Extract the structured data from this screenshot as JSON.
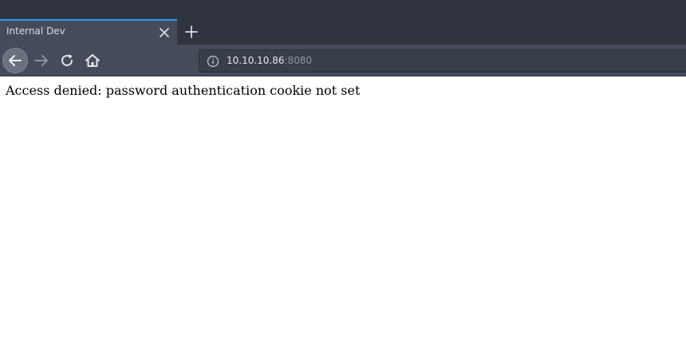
{
  "tab": {
    "title": "Internal Dev"
  },
  "navbar": {
    "url_host": "10.10.10.86",
    "url_port": ":8080"
  },
  "page": {
    "message": "Access denied: password authentication cookie not set"
  },
  "colors": {
    "tab_accent": "#2a9fe3",
    "chrome_bg": "#2f343f",
    "toolbar_bg": "#454b59"
  }
}
